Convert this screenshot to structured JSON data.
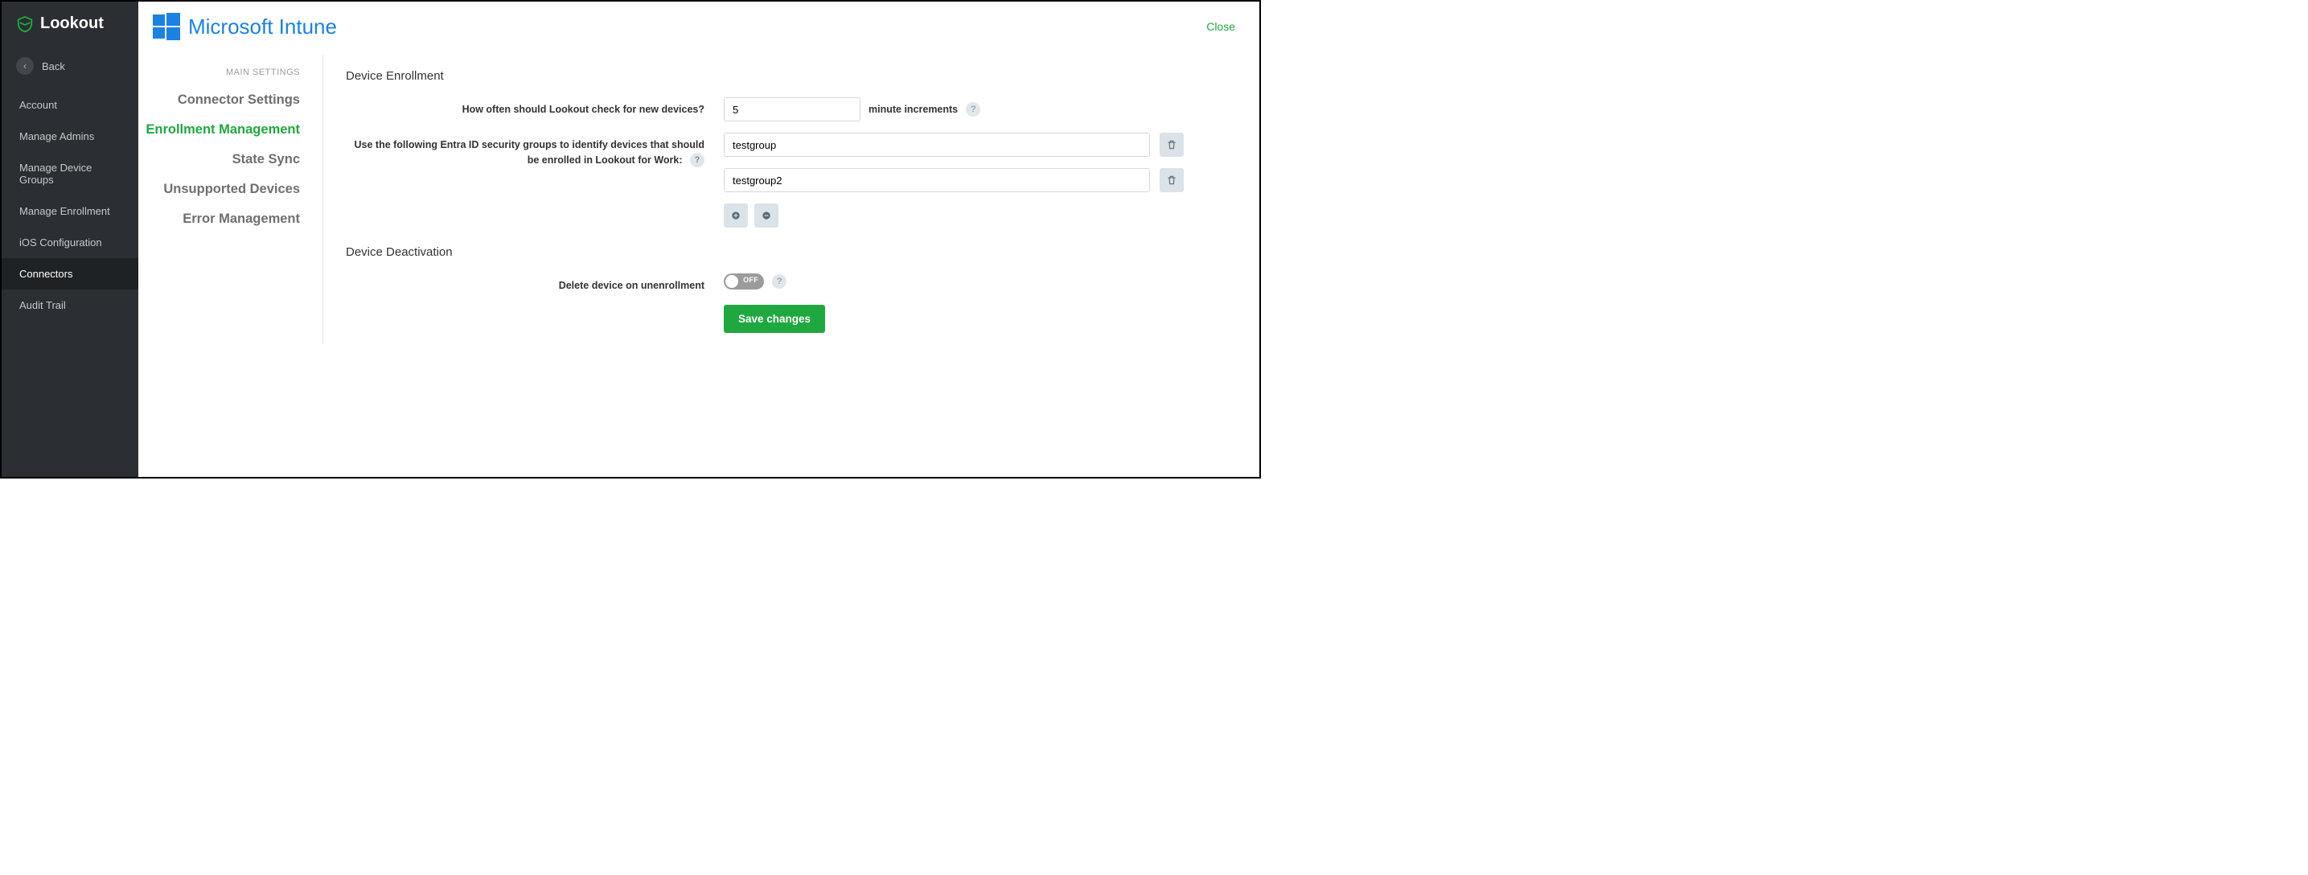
{
  "brand": "Lookout",
  "back": "Back",
  "nav": {
    "items": [
      {
        "label": "Account"
      },
      {
        "label": "Manage Admins"
      },
      {
        "label": "Manage Device Groups"
      },
      {
        "label": "Manage Enrollment"
      },
      {
        "label": "iOS Configuration"
      },
      {
        "label": "Connectors"
      },
      {
        "label": "Audit Trail"
      }
    ]
  },
  "header": {
    "product": "Microsoft Intune",
    "close": "Close"
  },
  "subnav": {
    "header": "MAIN SETTINGS",
    "items": [
      {
        "label": "Connector Settings"
      },
      {
        "label": "Enrollment Management"
      },
      {
        "label": "State Sync"
      },
      {
        "label": "Unsupported Devices"
      },
      {
        "label": "Error Management"
      }
    ]
  },
  "enroll": {
    "title": "Device Enrollment",
    "freq_label": "How often should Lookout check for new devices?",
    "freq_value": "5",
    "freq_suffix": "minute increments",
    "groups_label_pre": "Use the following ",
    "groups_label_bold": "Entra ID",
    "groups_label_post": " security groups to identify devices that should be enrolled in Lookout for Work:",
    "groups": [
      "testgroup",
      "testgroup2"
    ]
  },
  "deact": {
    "title": "Device Deactivation",
    "delete_label": "Delete device on unenrollment",
    "toggle_state": "OFF"
  },
  "save": "Save changes",
  "help": "?"
}
